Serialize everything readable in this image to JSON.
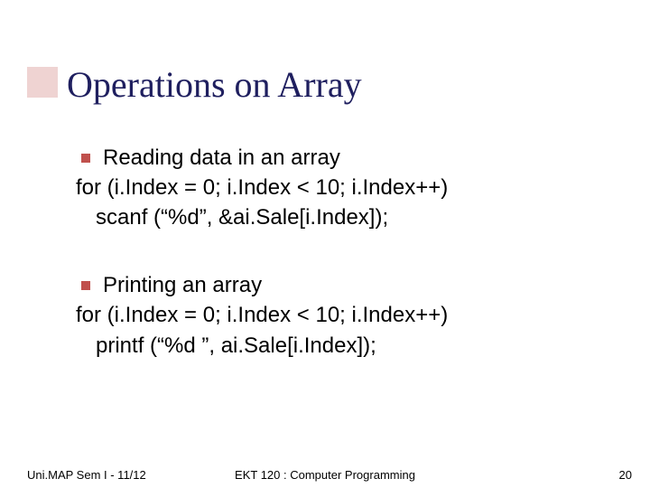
{
  "title": "Operations on Array",
  "block1": {
    "heading": "Reading data in an array",
    "line1": "for (i.Index = 0; i.Index < 10; i.Index++)",
    "line2": "scanf (“%d”, &ai.Sale[i.Index]);"
  },
  "block2": {
    "heading": "Printing an array",
    "line1": "for (i.Index = 0; i.Index < 10; i.Index++)",
    "line2": "printf (“%d ”, ai.Sale[i.Index]);"
  },
  "footer": {
    "left": "Uni.MAP Sem I - 11/12",
    "center": "EKT 120 : Computer Programming",
    "page": "20"
  }
}
